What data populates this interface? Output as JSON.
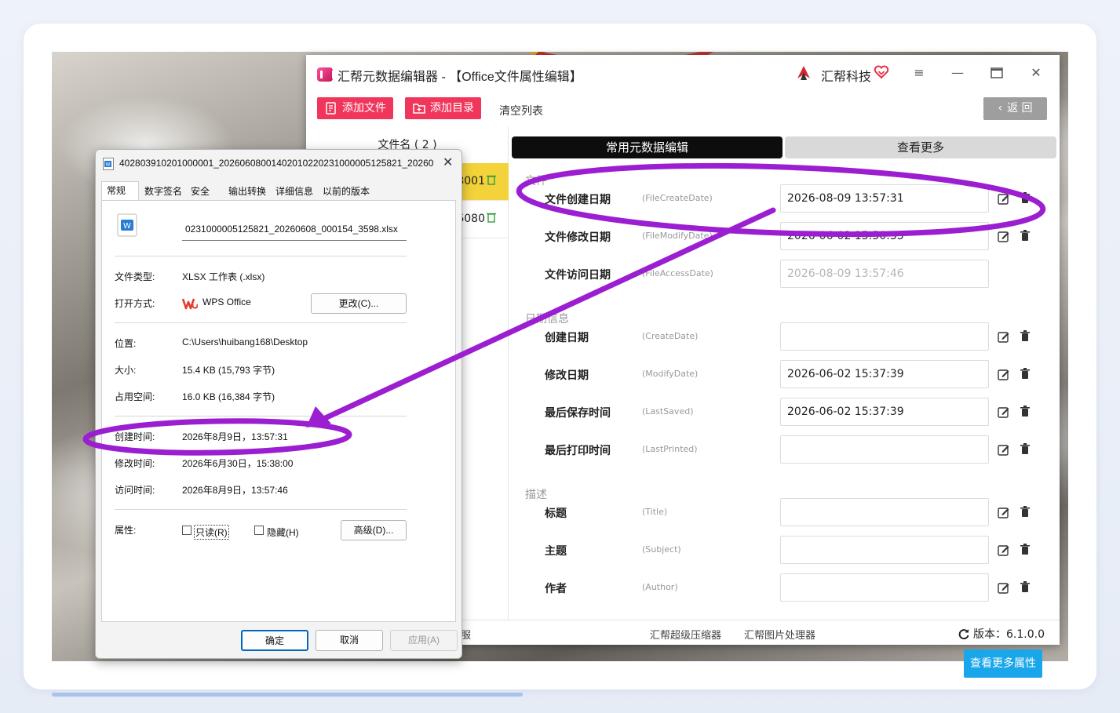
{
  "app": {
    "title": "汇帮元数据编辑器 - 【Office文件属性编辑】",
    "brand": "汇帮科技",
    "toolbar": {
      "add_file": "添加文件",
      "add_dir": "添加目录",
      "clear_list": "清空列表",
      "back": "返 回"
    },
    "file_list": {
      "header": "文件名 ( 2 )",
      "rows": [
        {
          "name_tail": "8001",
          "selected": true
        },
        {
          "name_tail": "6080",
          "selected": false
        }
      ]
    },
    "tabs": {
      "common": "常用元数据编辑",
      "more": "查看更多"
    },
    "sections": {
      "file": "文件",
      "date": "日期信息",
      "desc": "描述"
    },
    "fields": [
      {
        "label": "文件创建日期",
        "key": "(FileCreateDate)",
        "value": "2026-08-09 13:57:31",
        "disabled": false
      },
      {
        "label": "文件修改日期",
        "key": "(FileModifyDate)",
        "value": "2026-06-02 15:50:35",
        "disabled": false
      },
      {
        "label": "文件访问日期",
        "key": "(FileAccessDate)",
        "value": "2026-08-09 13:57:46",
        "disabled": true
      },
      {
        "label": "创建日期",
        "key": "(CreateDate)",
        "value": "",
        "disabled": false
      },
      {
        "label": "修改日期",
        "key": "(ModifyDate)",
        "value": "2026-06-02 15:37:39",
        "disabled": false
      },
      {
        "label": "最后保存时间",
        "key": "(LastSaved)",
        "value": "2026-06-02 15:37:39",
        "disabled": false
      },
      {
        "label": "最后打印时间",
        "key": "(LastPrinted)",
        "value": "",
        "disabled": false
      },
      {
        "label": "标题",
        "key": "(Title)",
        "value": "",
        "disabled": false
      },
      {
        "label": "主题",
        "key": "(Subject)",
        "value": "",
        "disabled": false
      },
      {
        "label": "作者",
        "key": "(Author)",
        "value": "",
        "disabled": false
      }
    ],
    "more_attr_button": "查看更多属性",
    "statusbar": {
      "left": "服",
      "compressor": "汇帮超级压缩器",
      "image_tool": "汇帮图片处理器",
      "version": "版本：6.1.0.0"
    },
    "colors": {
      "pink": "#f1365c",
      "selected_row": "#f3d23a",
      "blue_button": "#1aa6ea",
      "annotation": "#9b1fd1"
    }
  },
  "dialog": {
    "title": "402803910201000001_20260608001402010220231000005125821_202606...",
    "tabs": [
      "常规",
      "数字签名",
      "安全",
      "输出转换",
      "详细信息",
      "以前的版本"
    ],
    "filename": "0231000005125821_20260608_000154_3598.xlsx",
    "type_label": "文件类型:",
    "type_value": "XLSX 工作表 (.xlsx)",
    "open_label": "打开方式:",
    "open_value": "WPS Office",
    "change_button": "更改(C)...",
    "location_label": "位置:",
    "location_value": "C:\\Users\\huibang168\\Desktop",
    "size_label": "大小:",
    "size_value": "15.4 KB (15,793 字节)",
    "disk_label": "占用空间:",
    "disk_value": "16.0 KB (16,384 字节)",
    "created_label": "创建时间:",
    "created_value": "2026年8月9日，13:57:31",
    "modified_label": "修改时间:",
    "modified_value": "2026年6月30日，15:38:00",
    "accessed_label": "访问时间:",
    "accessed_value": "2026年8月9日，13:57:46",
    "attr_label": "属性:",
    "readonly_label": "只读(R)",
    "hidden_label": "隐藏(H)",
    "advanced_button": "高级(D)...",
    "ok": "确定",
    "cancel": "取消",
    "apply": "应用(A)"
  }
}
